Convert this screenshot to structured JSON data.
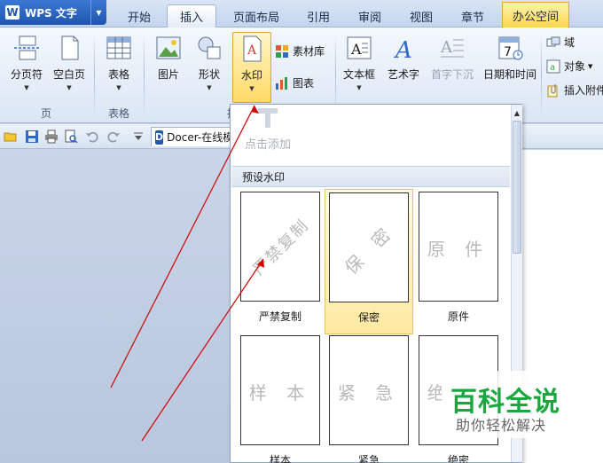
{
  "app": {
    "name": "WPS 文字",
    "logo_letter": "W"
  },
  "tabs": [
    "开始",
    "插入",
    "页面布局",
    "引用",
    "审阅",
    "视图",
    "章节",
    "办公空间"
  ],
  "active_tab": "插入",
  "ribbon": {
    "page_break": "分页符",
    "blank_page": "空白页",
    "table": "表格",
    "picture": "图片",
    "shape": "形状",
    "watermark": "水印",
    "material": "素材库",
    "chart": "图表",
    "textbox": "文本框",
    "art_text": "艺术字",
    "drop_cap": "首字下沉",
    "datetime": "日期和时间",
    "field": "域",
    "object": "对象",
    "attachment": "插入附件",
    "group_page": "页",
    "group_table": "表格",
    "group_partial": "插"
  },
  "quick": {
    "docer_tab": "Docer-在线模板"
  },
  "watermark_panel": {
    "add_label": "点击添加",
    "section_title": "预设水印",
    "items": [
      {
        "label": "严禁复制",
        "text": "严禁复制"
      },
      {
        "label": "保密",
        "text": "保 密"
      },
      {
        "label": "原件",
        "text": "原 件"
      },
      {
        "label": "样本",
        "text": "样 本"
      },
      {
        "label": "紧急",
        "text": "紧 急"
      },
      {
        "label": "绝密",
        "text": "绝 密"
      }
    ]
  },
  "badge": {
    "title": "百科全说",
    "subtitle": "助你轻松解决"
  },
  "colors": {
    "accent": "#2f6ac9",
    "selected": "#ffd966",
    "badge_green": "#18a83d",
    "arrow": "#d40000"
  }
}
